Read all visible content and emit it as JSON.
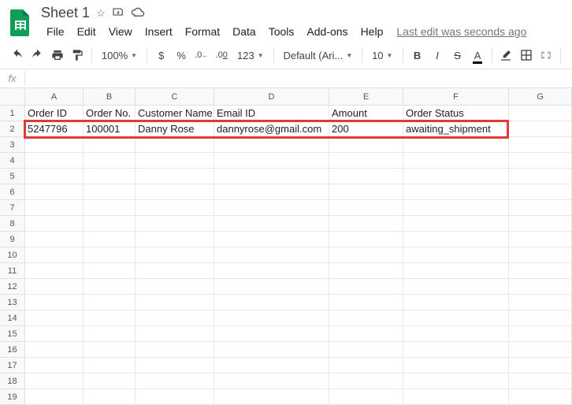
{
  "doc": {
    "title": "Sheet 1",
    "last_edit": "Last edit was seconds ago"
  },
  "menus": {
    "file": "File",
    "edit": "Edit",
    "view": "View",
    "insert": "Insert",
    "format": "Format",
    "data": "Data",
    "tools": "Tools",
    "addons": "Add-ons",
    "help": "Help"
  },
  "toolbar": {
    "zoom": "100%",
    "currency": "$",
    "percent": "%",
    "dec_less": ".0",
    "dec_more": ".00",
    "more_fmt": "123",
    "font": "Default (Ari...",
    "size": "10",
    "bold": "B",
    "italic": "I",
    "strike": "S",
    "text_color": "A"
  },
  "fx": {
    "label": "fx",
    "value": ""
  },
  "columns": [
    "A",
    "B",
    "C",
    "D",
    "E",
    "F",
    "G"
  ],
  "rows": [
    "1",
    "2",
    "3",
    "4",
    "5",
    "6",
    "7",
    "8",
    "9",
    "10",
    "11",
    "12",
    "13",
    "14",
    "15",
    "16",
    "17",
    "18",
    "19"
  ],
  "data": {
    "r1": {
      "A": "Order ID",
      "B": "Order No.",
      "C": "Customer Name",
      "D": "Email ID",
      "E": "Amount",
      "F": "Order Status"
    },
    "r2": {
      "A": "5247796",
      "B": "100001",
      "C": "Danny Rose",
      "D": "dannyrose@gmail.com",
      "E": "200",
      "F": "awaiting_shipment"
    }
  }
}
